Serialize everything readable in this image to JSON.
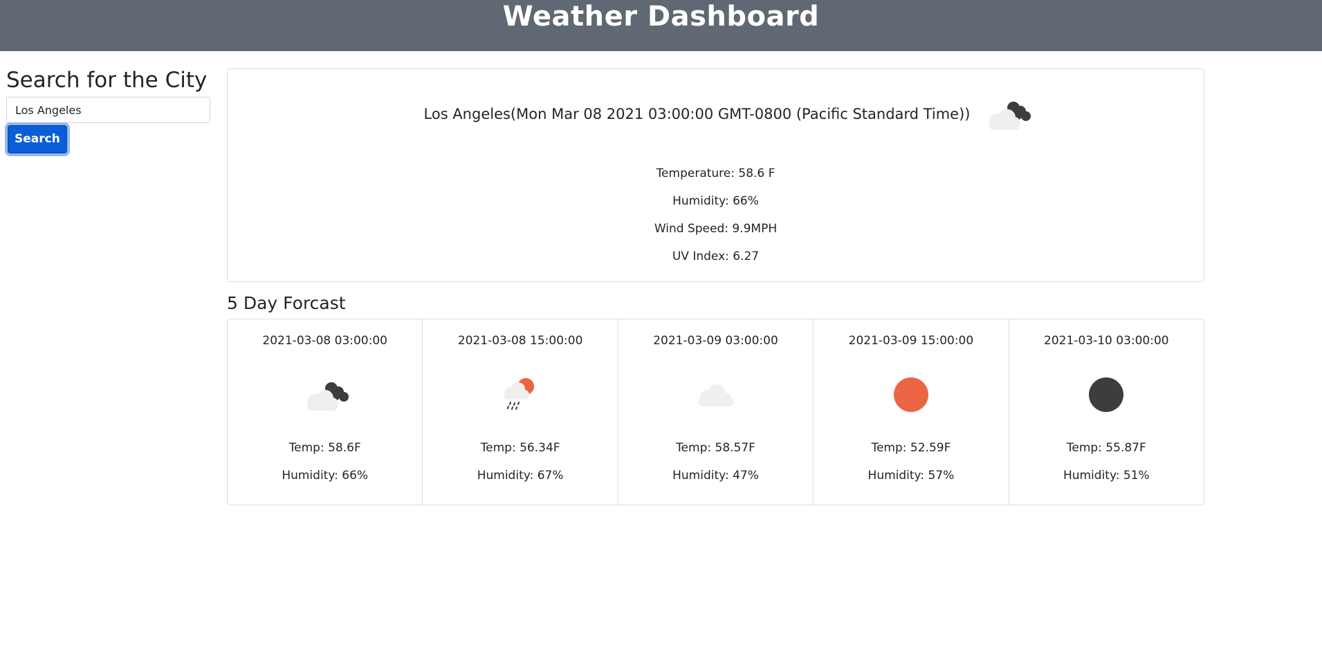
{
  "header": {
    "title": "Weather Dashboard"
  },
  "search": {
    "heading": "Search for the City",
    "input_value": "Los Angeles",
    "button_label": "Search"
  },
  "current": {
    "heading": "Los Angeles(Mon Mar 08 2021 03:00:00 GMT-0800 (Pacific Standard Time))",
    "icon": "broken-clouds-icon",
    "temperature": "Temperature: 58.6 F",
    "humidity": "Humidity: 66%",
    "wind": "Wind Speed: 9.9MPH",
    "uv": "UV Index: 6.27"
  },
  "forecast": {
    "heading": "5 Day Forcast",
    "days": [
      {
        "date": "2021-03-08 03:00:00",
        "icon": "broken-clouds-icon",
        "temp": "Temp: 58.6F",
        "humidity": "Humidity: 66%"
      },
      {
        "date": "2021-03-08 15:00:00",
        "icon": "rain-sun-icon",
        "temp": "Temp: 56.34F",
        "humidity": "Humidity: 67%"
      },
      {
        "date": "2021-03-09 03:00:00",
        "icon": "cloud-icon",
        "temp": "Temp: 58.57F",
        "humidity": "Humidity: 47%"
      },
      {
        "date": "2021-03-09 15:00:00",
        "icon": "sun-icon",
        "temp": "Temp: 52.59F",
        "humidity": "Humidity: 57%"
      },
      {
        "date": "2021-03-10 03:00:00",
        "icon": "moon-icon",
        "temp": "Temp: 55.87F",
        "humidity": "Humidity: 51%"
      }
    ]
  },
  "colors": {
    "header_bg": "#606873",
    "button_bg": "#0b5ed7",
    "sun": "#eb6544",
    "dark_cloud": "#3d3d3d",
    "light_cloud": "#efefef"
  }
}
